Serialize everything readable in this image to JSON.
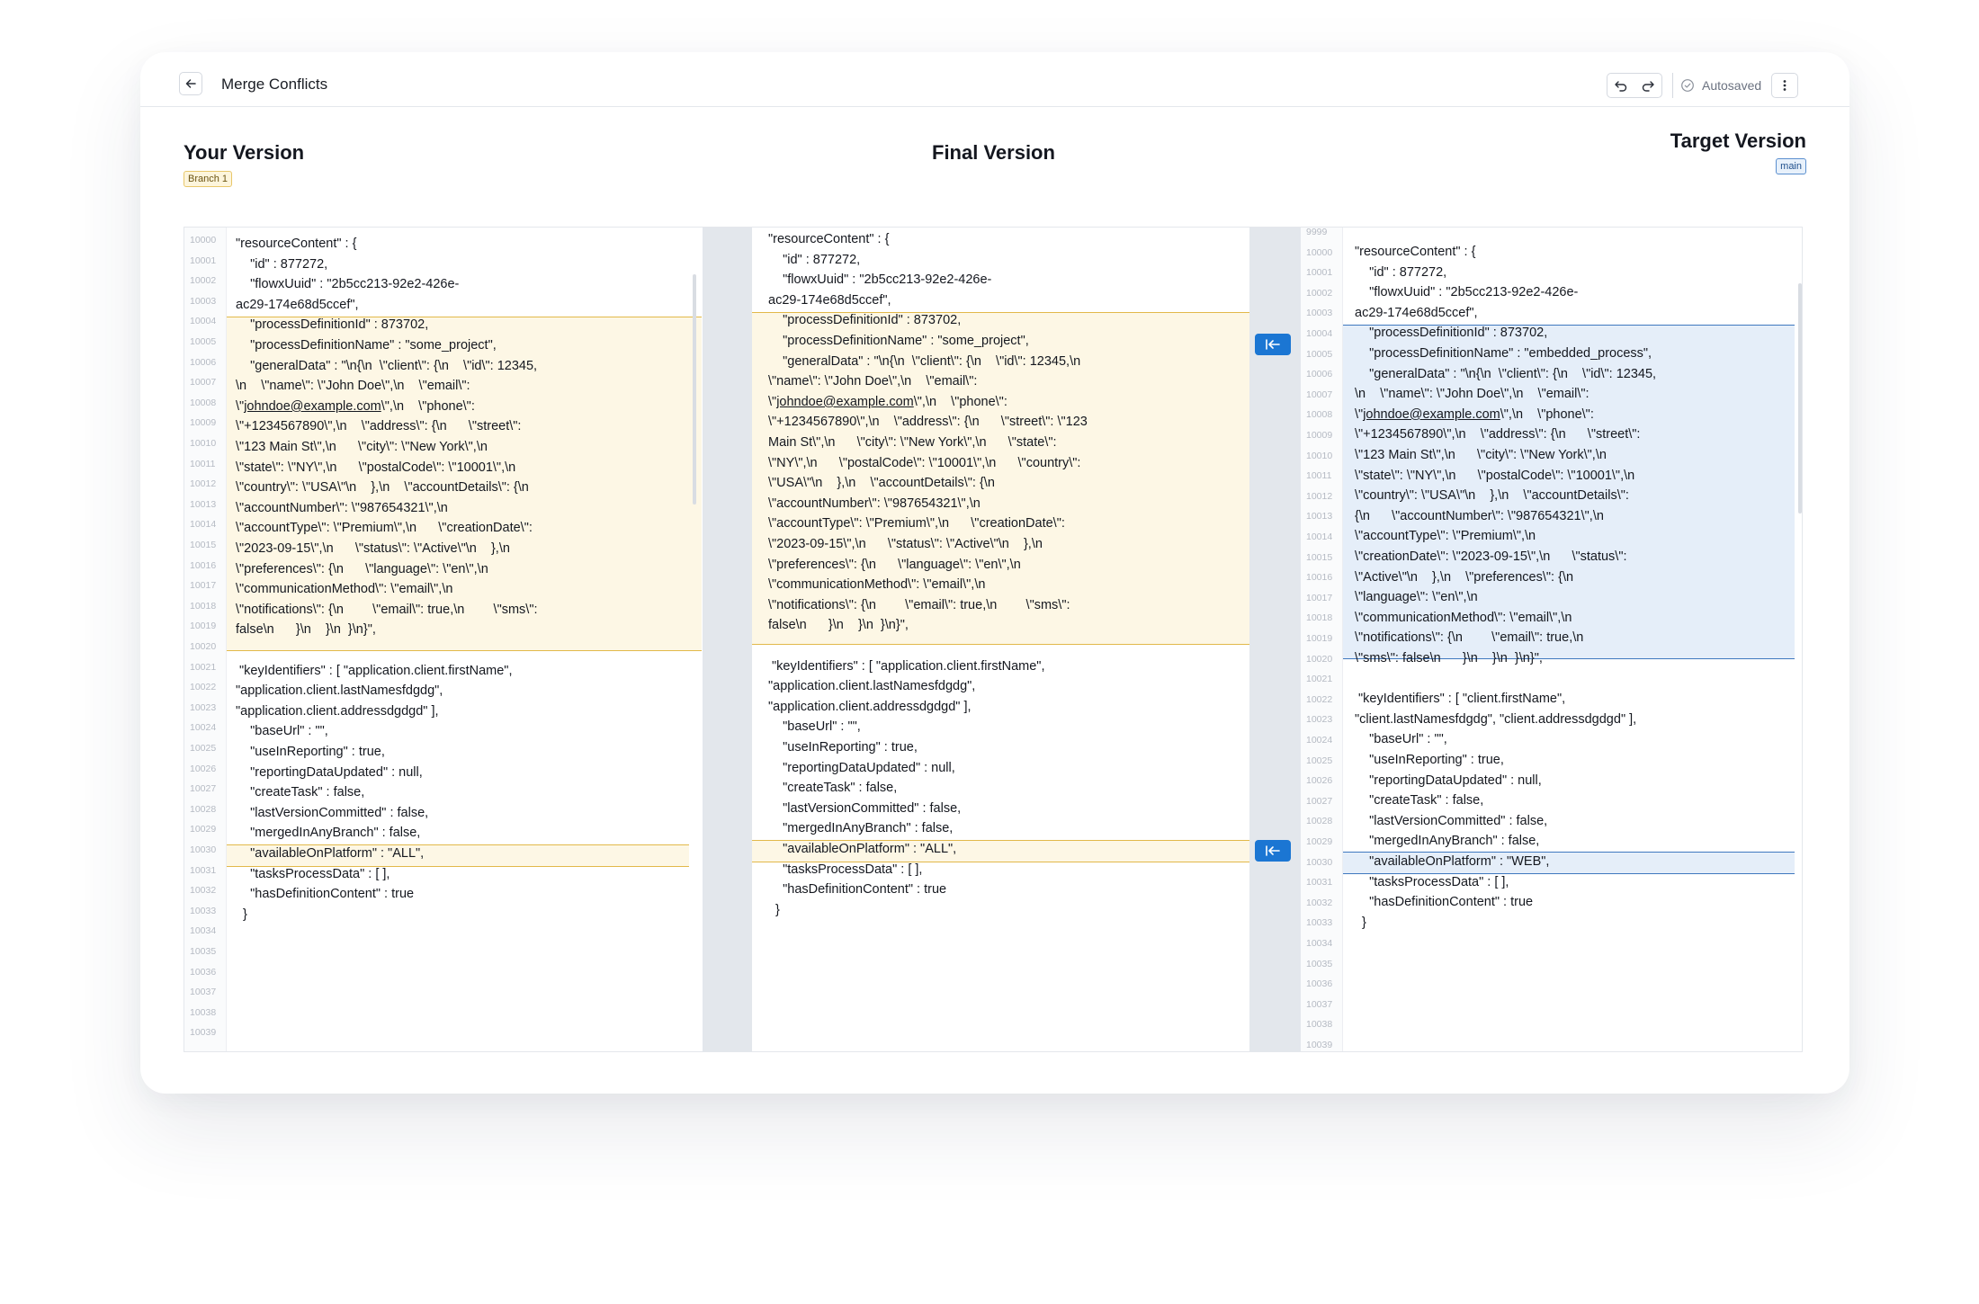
{
  "header": {
    "title": "Merge Conflicts",
    "autosaved_label": "Autosaved",
    "icons": [
      "arrow-left-icon",
      "undo-icon",
      "redo-icon",
      "check-circle-icon",
      "more-vertical-icon"
    ]
  },
  "panes": {
    "yours": {
      "title": "Your Version",
      "badge": "Branch 1"
    },
    "final": {
      "title": "Final Version"
    },
    "target": {
      "title": "Target Version",
      "badge": "main"
    }
  },
  "colors": {
    "accent": "#1b76d3",
    "conflict_yours_bg": "#fdf7e5",
    "conflict_yours_border": "#e2b94a",
    "conflict_target_bg": "#e5eef9",
    "conflict_target_border": "#3f78bf"
  },
  "yours": {
    "first_line": 10000,
    "line_count": 40,
    "lines": [
      "\"resourceContent\" : {",
      "    \"id\" : 877272,",
      "    \"flowxUuid\" : \"2b5cc213-92e2-426e-",
      "ac29-174e68d5ccef\",",
      "    \"processDefinitionId\" : 873702,",
      "    \"processDefinitionName\" : \"some_project\",",
      "    \"generalData\" : \"\\n{\\n  \\\"client\\\": {\\n    \\\"id\\\": 12345,",
      "\\n    \\\"name\\\": \\\"John Doe\\\",\\n    \\\"email\\\":",
      "\\\"johndoe@example.com\\\",\\n    \\\"phone\\\":",
      "\\\"+1234567890\\\",\\n    \\\"address\\\": {\\n      \\\"street\\\":",
      "\\\"123 Main St\\\",\\n      \\\"city\\\": \\\"New York\\\",\\n",
      "\\\"state\\\": \\\"NY\\\",\\n      \\\"postalCode\\\": \\\"10001\\\",\\n",
      "\\\"country\\\": \\\"USA\\\"\\n    },\\n    \\\"accountDetails\\\": {\\n",
      "\\\"accountNumber\\\": \\\"987654321\\\",\\n",
      "\\\"accountType\\\": \\\"Premium\\\",\\n      \\\"creationDate\\\":",
      "\\\"2023-09-15\\\",\\n      \\\"status\\\": \\\"Active\\\"\\n    },\\n",
      "\\\"preferences\\\": {\\n      \\\"language\\\": \\\"en\\\",\\n",
      "\\\"communicationMethod\\\": \\\"email\\\",\\n",
      "\\\"notifications\\\": {\\n        \\\"email\\\": true,\\n        \\\"sms\\\":",
      "false\\n      }\\n    }\\n  }\\n}\",",
      "",
      " \"keyIdentifiers\" : [ \"application.client.firstName\",",
      "\"application.client.lastNamesfdgdg\",",
      "\"application.client.addressdgdgd\" ],",
      "    \"baseUrl\" : \"\",",
      "    \"useInReporting\" : true,",
      "    \"reportingDataUpdated\" : null,",
      "    \"createTask\" : false,",
      "    \"lastVersionCommitted\" : false,",
      "    \"mergedInAnyBranch\" : false,",
      "    \"availableOnPlatform\" : \"ALL\",",
      "    \"tasksProcessData\" : [ ],",
      "    \"hasDefinitionContent\" : true",
      "  }"
    ]
  },
  "final": {
    "lines": [
      "\"resourceContent\" : {",
      "    \"id\" : 877272,",
      "    \"flowxUuid\" : \"2b5cc213-92e2-426e-",
      "ac29-174e68d5ccef\",",
      "    \"processDefinitionId\" : 873702,",
      "    \"processDefinitionName\" : \"some_project\",",
      "    \"generalData\" : \"\\n{\\n  \\\"client\\\": {\\n    \\\"id\\\": 12345,\\n",
      "\\\"name\\\": \\\"John Doe\\\",\\n    \\\"email\\\":",
      "\\\"johndoe@example.com\\\",\\n    \\\"phone\\\":",
      "\\\"+1234567890\\\",\\n    \\\"address\\\": {\\n      \\\"street\\\": \\\"123",
      "Main St\\\",\\n      \\\"city\\\": \\\"New York\\\",\\n      \\\"state\\\":",
      "\\\"NY\\\",\\n      \\\"postalCode\\\": \\\"10001\\\",\\n      \\\"country\\\":",
      "\\\"USA\\\"\\n    },\\n    \\\"accountDetails\\\": {\\n",
      "\\\"accountNumber\\\": \\\"987654321\\\",\\n",
      "\\\"accountType\\\": \\\"Premium\\\",\\n      \\\"creationDate\\\":",
      "\\\"2023-09-15\\\",\\n      \\\"status\\\": \\\"Active\\\"\\n    },\\n",
      "\\\"preferences\\\": {\\n      \\\"language\\\": \\\"en\\\",\\n",
      "\\\"communicationMethod\\\": \\\"email\\\",\\n",
      "\\\"notifications\\\": {\\n        \\\"email\\\": true,\\n        \\\"sms\\\":",
      "false\\n      }\\n    }\\n  }\\n}\",",
      "",
      " \"keyIdentifiers\" : [ \"application.client.firstName\",",
      "\"application.client.lastNamesfdgdg\",",
      "\"application.client.addressdgdgd\" ],",
      "    \"baseUrl\" : \"\",",
      "    \"useInReporting\" : true,",
      "    \"reportingDataUpdated\" : null,",
      "    \"createTask\" : false,",
      "    \"lastVersionCommitted\" : false,",
      "    \"mergedInAnyBranch\" : false,",
      "    \"availableOnPlatform\" : \"ALL\",",
      "    \"tasksProcessData\" : [ ],",
      "    \"hasDefinitionContent\" : true",
      "  }"
    ]
  },
  "target": {
    "first_line": 9999,
    "line_count": 41,
    "lines": [
      "\"resourceContent\" : {",
      "    \"id\" : 877272,",
      "    \"flowxUuid\" : \"2b5cc213-92e2-426e-",
      "ac29-174e68d5ccef\",",
      "    \"processDefinitionId\" : 873702,",
      "    \"processDefinitionName\" : \"embedded_process\",",
      "    \"generalData\" : \"\\n{\\n  \\\"client\\\": {\\n    \\\"id\\\": 12345,",
      "\\n    \\\"name\\\": \\\"John Doe\\\",\\n    \\\"email\\\":",
      "\\\"johndoe@example.com\\\",\\n    \\\"phone\\\":",
      "\\\"+1234567890\\\",\\n    \\\"address\\\": {\\n      \\\"street\\\":",
      "\\\"123 Main St\\\",\\n      \\\"city\\\": \\\"New York\\\",\\n",
      "\\\"state\\\": \\\"NY\\\",\\n      \\\"postalCode\\\": \\\"10001\\\",\\n",
      "\\\"country\\\": \\\"USA\\\"\\n    },\\n    \\\"accountDetails\\\":",
      "{\\n      \\\"accountNumber\\\": \\\"987654321\\\",\\n",
      "\\\"accountType\\\": \\\"Premium\\\",\\n",
      "\\\"creationDate\\\": \\\"2023-09-15\\\",\\n      \\\"status\\\":",
      "\\\"Active\\\"\\n    },\\n    \\\"preferences\\\": {\\n",
      "\\\"language\\\": \\\"en\\\",\\n",
      "\\\"communicationMethod\\\": \\\"email\\\",\\n",
      "\\\"notifications\\\": {\\n        \\\"email\\\": true,\\n",
      "\\\"sms\\\": false\\n      }\\n    }\\n  }\\n}\",",
      "",
      " \"keyIdentifiers\" : [ \"client.firstName\",",
      "\"client.lastNamesfdgdg\", \"client.addressdgdgd\" ],",
      "    \"baseUrl\" : \"\",",
      "    \"useInReporting\" : true,",
      "    \"reportingDataUpdated\" : null,",
      "    \"createTask\" : false,",
      "    \"lastVersionCommitted\" : false,",
      "    \"mergedInAnyBranch\" : false,",
      "    \"availableOnPlatform\" : \"WEB\",",
      "    \"tasksProcessData\" : [ ],",
      "    \"hasDefinitionContent\" : true",
      "  }"
    ]
  }
}
